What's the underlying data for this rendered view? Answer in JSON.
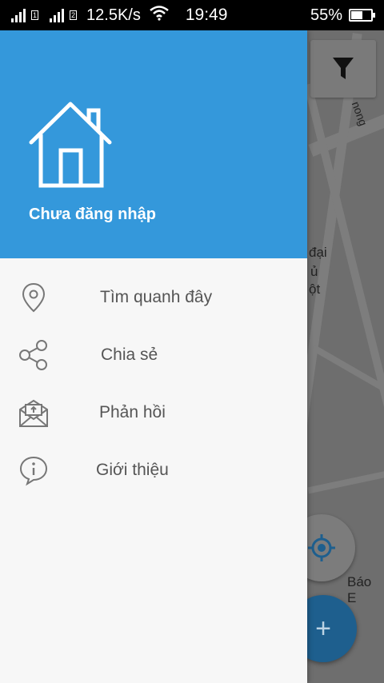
{
  "status_bar": {
    "sim1": "1",
    "sim2": "2",
    "speed": "12.5K/s",
    "time": "19:49",
    "battery": "55%",
    "battery_level": 0.55
  },
  "map": {
    "labels": [
      "nong",
      "đại",
      "ủ",
      "ột",
      "Báo E"
    ]
  },
  "drawer": {
    "header": {
      "login_text": "Chưa đăng nhập",
      "icon": "house-icon"
    },
    "menu": [
      {
        "label": "Tìm quanh đây",
        "icon": "location-pin-icon"
      },
      {
        "label": "Chia sẻ",
        "icon": "share-icon"
      },
      {
        "label": "Phản hồi",
        "icon": "feedback-envelope-icon"
      },
      {
        "label": "Giới thiệu",
        "icon": "info-icon"
      }
    ]
  },
  "colors": {
    "header": "#3498db",
    "drawer_bg": "#f7f7f7",
    "fab": "#1e5f8e",
    "menu_text": "#555555"
  }
}
